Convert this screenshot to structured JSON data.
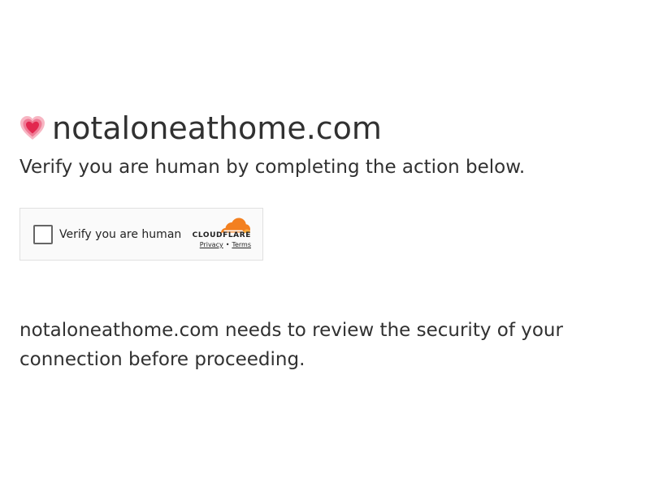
{
  "site": {
    "domain": "notaloneathome.com",
    "favicon_icon": "heart-icon"
  },
  "challenge": {
    "heading": "Verify you are human by completing the action below.",
    "security_note": "notaloneathome.com needs to review the security of your connection before proceeding."
  },
  "turnstile": {
    "checkbox_label": "Verify you are human",
    "brand": "CLOUDFLARE",
    "privacy_link": "Privacy",
    "separator": "•",
    "terms_link": "Terms",
    "brand_color": "#f38020",
    "brand_color_light": "#fbad41"
  }
}
